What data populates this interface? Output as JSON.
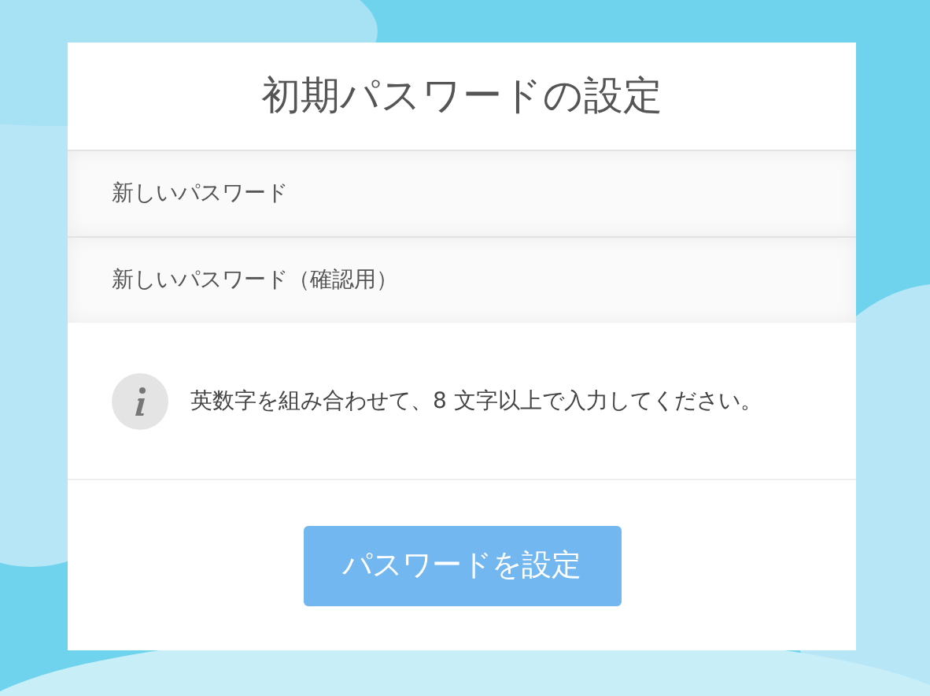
{
  "title": "初期パスワードの設定",
  "fields": [
    {
      "placeholder": "新しいパスワード"
    },
    {
      "placeholder": "新しいパスワード（確認用）"
    }
  ],
  "notice": {
    "text": "英数字を組み合わせて、8 文字以上で入力してください。"
  },
  "submit_button": {
    "label": "パスワードを設定",
    "disabled": true
  }
}
